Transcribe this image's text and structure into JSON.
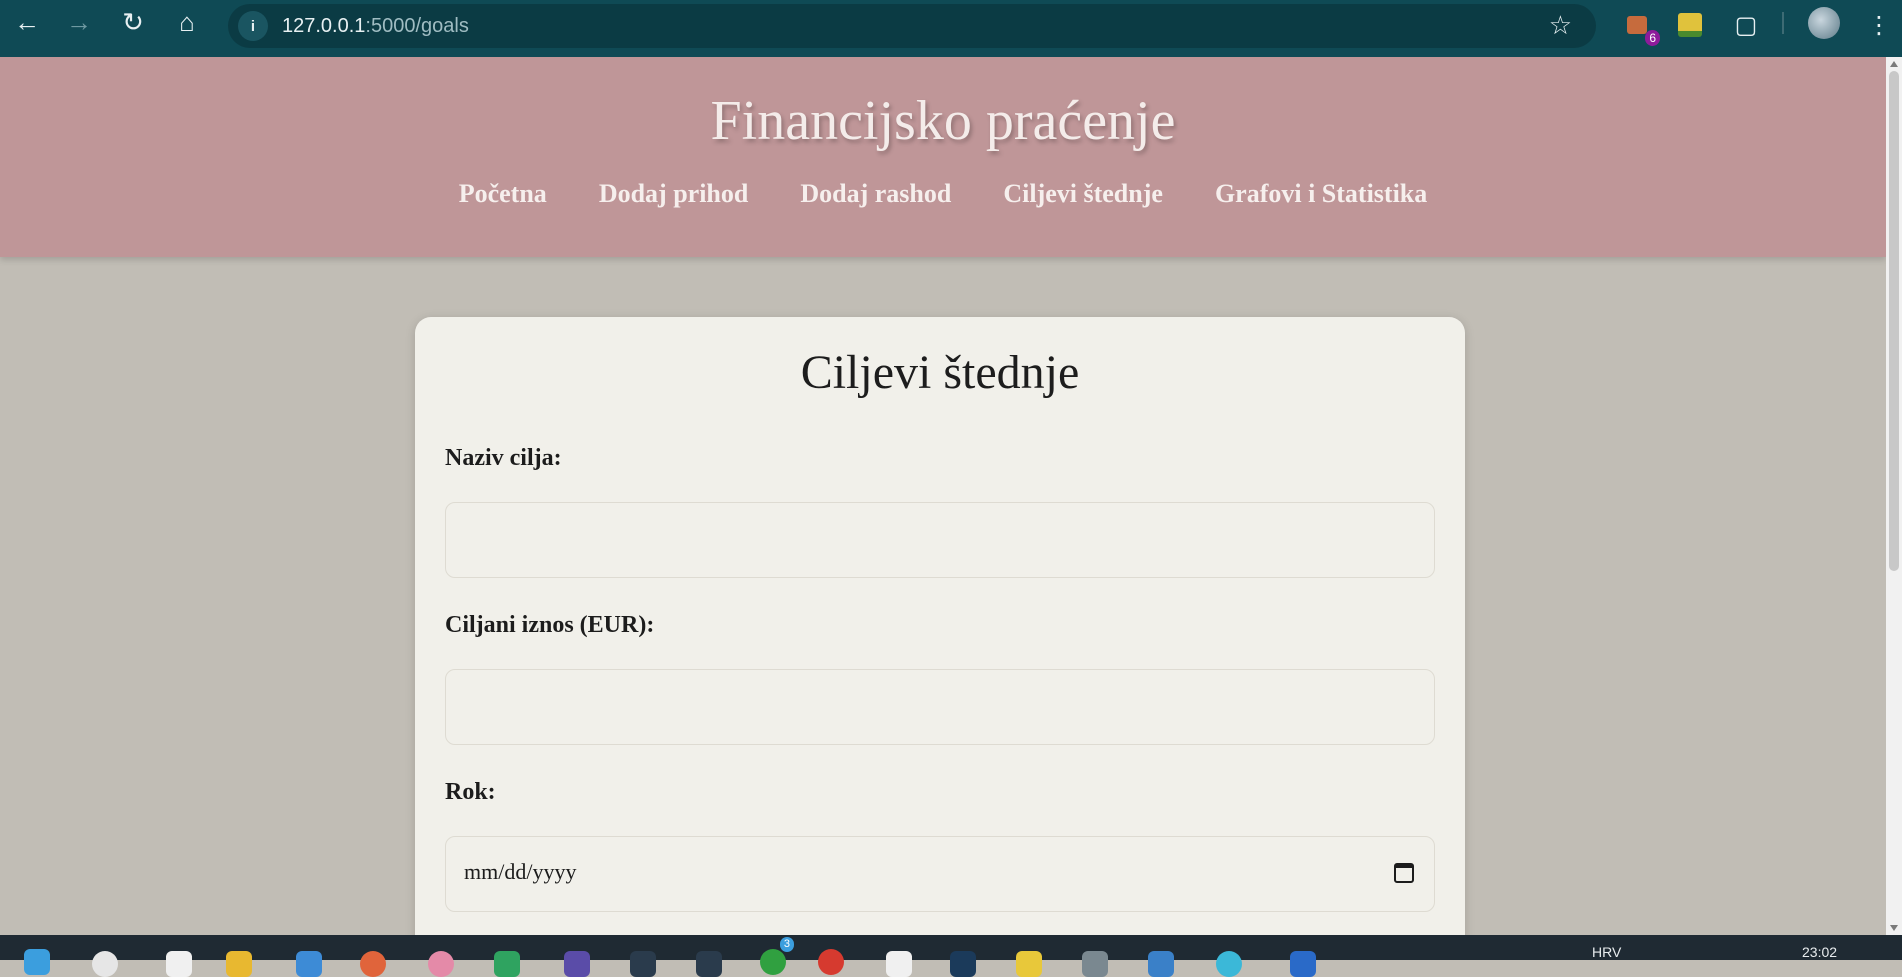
{
  "browser": {
    "url_host": "127.0.0.1",
    "url_path": ":5000/goals",
    "extension_badge": "6"
  },
  "site": {
    "title": "Financijsko praćenje",
    "nav": [
      {
        "label": "Početna"
      },
      {
        "label": "Dodaj prihod"
      },
      {
        "label": "Dodaj rashod"
      },
      {
        "label": "Ciljevi štednje"
      },
      {
        "label": "Grafovi i Statistika"
      }
    ]
  },
  "form": {
    "heading": "Ciljevi štednje",
    "goal_name_label": "Naziv cilja:",
    "goal_name_value": "",
    "target_amount_label": "Ciljani iznos (EUR):",
    "target_amount_value": "",
    "deadline_label": "Rok:",
    "deadline_placeholder": "mm/dd/yyyy"
  },
  "taskbar": {
    "lang": "HRV",
    "time": "23:02",
    "notification_badge": "3"
  },
  "colors": {
    "chrome": "#0f4a55",
    "header": "#bf9698",
    "page_bg": "#c1bdb5",
    "card_bg": "#f1f0ea"
  }
}
